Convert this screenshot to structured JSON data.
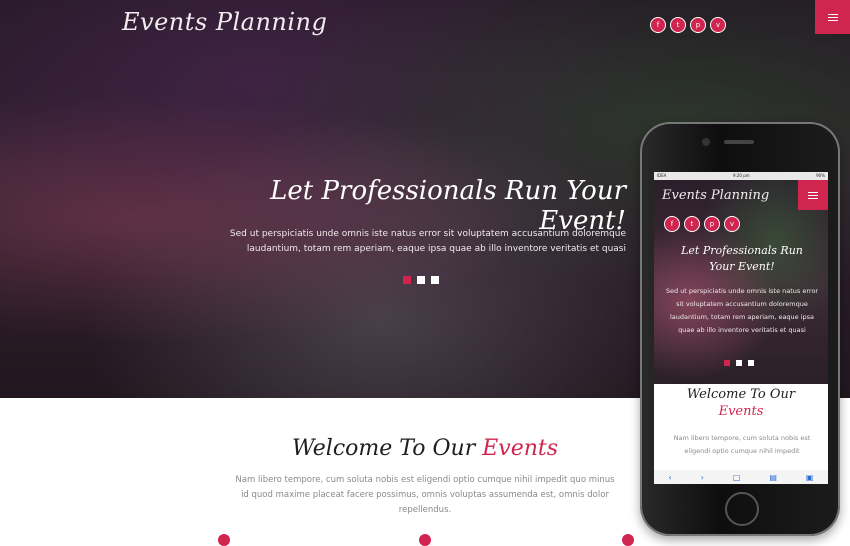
{
  "site": {
    "logo": "Events Planning",
    "social": [
      "f",
      "t",
      "p",
      "v"
    ],
    "social_icons": [
      "facebook-icon",
      "twitter-icon",
      "dribbble-icon",
      "vimeo-icon"
    ]
  },
  "hero": {
    "headline": "Let Professionals Run Your Event!",
    "text": "Sed ut perspiciatis unde omnis iste natus error sit voluptatem accusantium doloremque laudantium, totam rem aperiam, eaque ipsa quae ab illo inventore veritatis et quasi",
    "slides": 3,
    "active_slide": 1
  },
  "welcome": {
    "title": "Welcome To Our",
    "title_accent": "Events",
    "text": "Nam libero tempore, cum soluta nobis est eligendi optio cumque nihil impedit quo minus id quod maxime placeat facere possimus, omnis voluptas assumenda est, omnis dolor repellendus."
  },
  "phone": {
    "status_left": "IDEA",
    "status_time": "9:20 pm",
    "status_battery": "90%",
    "logo": "Events Planning",
    "headline": "Let Professionals Run Your Event!",
    "text": "Sed ut perspiciatis unde omnis iste natus error sit voluptatem accusantium doloremque laudantium, totam rem aperiam, eaque ipsa quae ab illo inventore veritatis et quasi",
    "welcome_title": "Welcome To Our",
    "welcome_accent": "Events",
    "welcome_text": "Nam libero tempore, cum soluta nobis est eligendi optio cumque nihil impedit"
  },
  "colors": {
    "accent": "#d0254f",
    "hero_dark": "#2b1f2c"
  }
}
